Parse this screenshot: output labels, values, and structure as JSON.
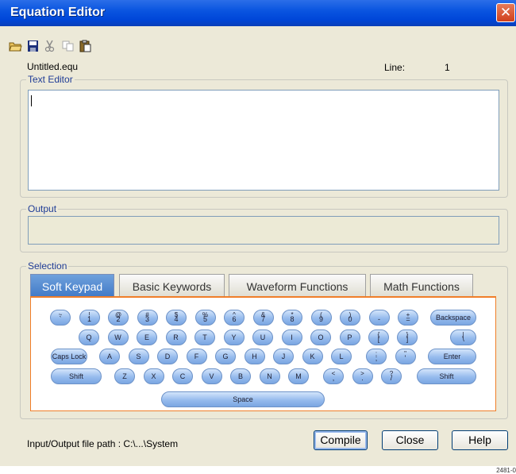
{
  "window": {
    "title": "Equation Editor",
    "close_glyph": "✕"
  },
  "toolbar": {
    "icons": [
      "open-folder-icon",
      "save-icon",
      "cut-icon",
      "copy-icon",
      "paste-icon"
    ]
  },
  "file": {
    "name": "Untitled.equ",
    "line_label": "Line:",
    "line_value": "1"
  },
  "text_editor": {
    "legend": "Text Editor",
    "value": ""
  },
  "output": {
    "legend": "Output",
    "value": ""
  },
  "selection": {
    "legend": "Selection",
    "tabs": [
      {
        "label": "Soft Keypad",
        "active": true
      },
      {
        "label": "Basic Keywords",
        "active": false
      },
      {
        "label": "Waveform Functions",
        "active": false
      },
      {
        "label": "Math Functions",
        "active": false
      }
    ]
  },
  "keypad": {
    "row1": [
      {
        "top": "~",
        "bot": "`"
      },
      {
        "top": "!",
        "bot": "1"
      },
      {
        "top": "@",
        "bot": "2"
      },
      {
        "top": "#",
        "bot": "3"
      },
      {
        "top": "$",
        "bot": "4"
      },
      {
        "top": "%",
        "bot": "5"
      },
      {
        "top": "^",
        "bot": "6"
      },
      {
        "top": "&",
        "bot": "7"
      },
      {
        "top": "*",
        "bot": "8"
      },
      {
        "top": "(",
        "bot": "9"
      },
      {
        "top": ")",
        "bot": "0"
      },
      {
        "top": "",
        "bot": "-"
      },
      {
        "top": "+",
        "bot": "="
      }
    ],
    "backspace": "Backspace",
    "row2": [
      "Q",
      "W",
      "E",
      "R",
      "T",
      "Y",
      "U",
      "I",
      "O",
      "P"
    ],
    "row2_extra": [
      {
        "top": "{",
        "bot": "["
      },
      {
        "top": "}",
        "bot": "]"
      },
      {
        "top": "|",
        "bot": "\\"
      }
    ],
    "caps_lock": "Caps Lock",
    "row3": [
      "A",
      "S",
      "D",
      "F",
      "G",
      "H",
      "J",
      "K",
      "L"
    ],
    "row3_extra": [
      {
        "top": ":",
        "bot": ";"
      },
      {
        "top": "\"",
        "bot": "'"
      }
    ],
    "enter": "Enter",
    "shift": "Shift",
    "row4": [
      "Z",
      "X",
      "C",
      "V",
      "B",
      "N",
      "M"
    ],
    "row4_extra": [
      {
        "top": "<",
        "bot": ","
      },
      {
        "top": ">",
        "bot": "."
      },
      {
        "top": "?",
        "bot": "/"
      }
    ],
    "space": "Space"
  },
  "footer": {
    "path_label": "Input/Output file path : C:\\...\\System",
    "compile": "Compile",
    "close": "Close",
    "help": "Help"
  },
  "corner_id": "2481-0"
}
